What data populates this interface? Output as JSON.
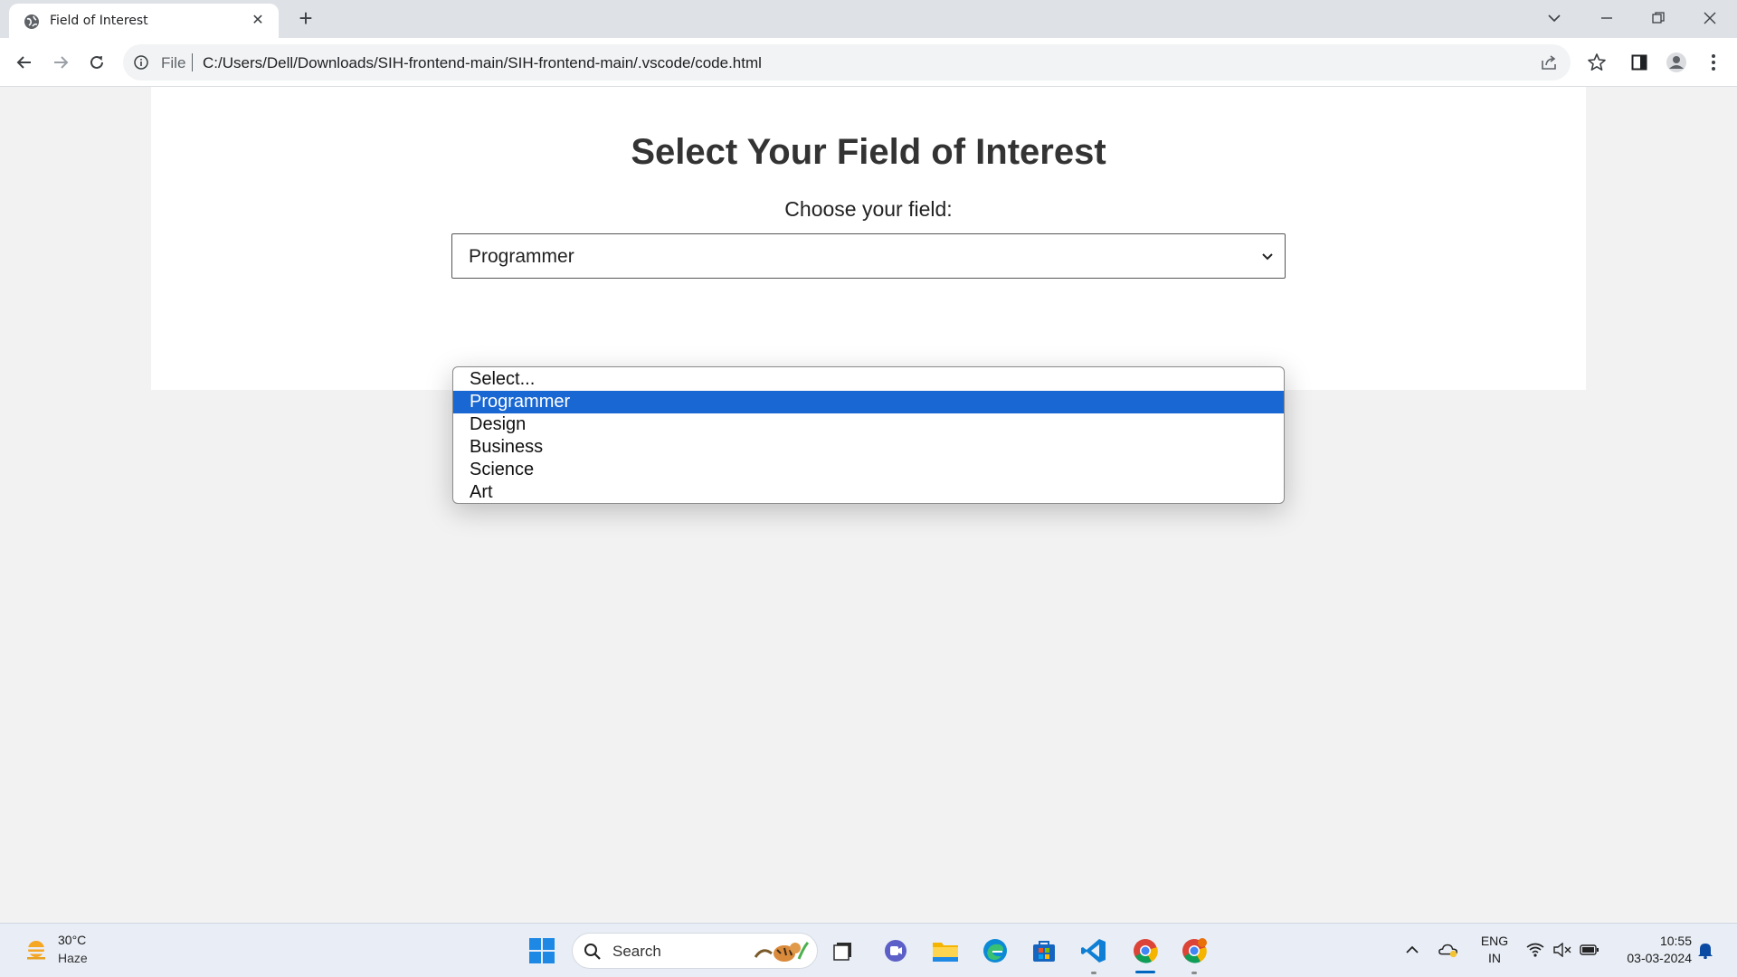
{
  "browser": {
    "tab_title": "Field of Interest",
    "address_scheme": "File",
    "address_url": "C:/Users/Dell/Downloads/SIH-frontend-main/SIH-frontend-main/.vscode/code.html"
  },
  "page": {
    "heading": "Select Your Field of Interest",
    "field_label": "Choose your field:",
    "selected_value": "Programmer",
    "options": [
      "Select...",
      "Programmer",
      "Design",
      "Business",
      "Science",
      "Art"
    ],
    "highlighted_index": 1
  },
  "taskbar": {
    "weather_temp": "30°C",
    "weather_desc": "Haze",
    "search_label": "Search",
    "lang_line1": "ENG",
    "lang_line2": "IN",
    "time": "10:55",
    "date": "03-03-2024"
  },
  "colors": {
    "highlight": "#1967d2",
    "accent": "#0067c0"
  }
}
